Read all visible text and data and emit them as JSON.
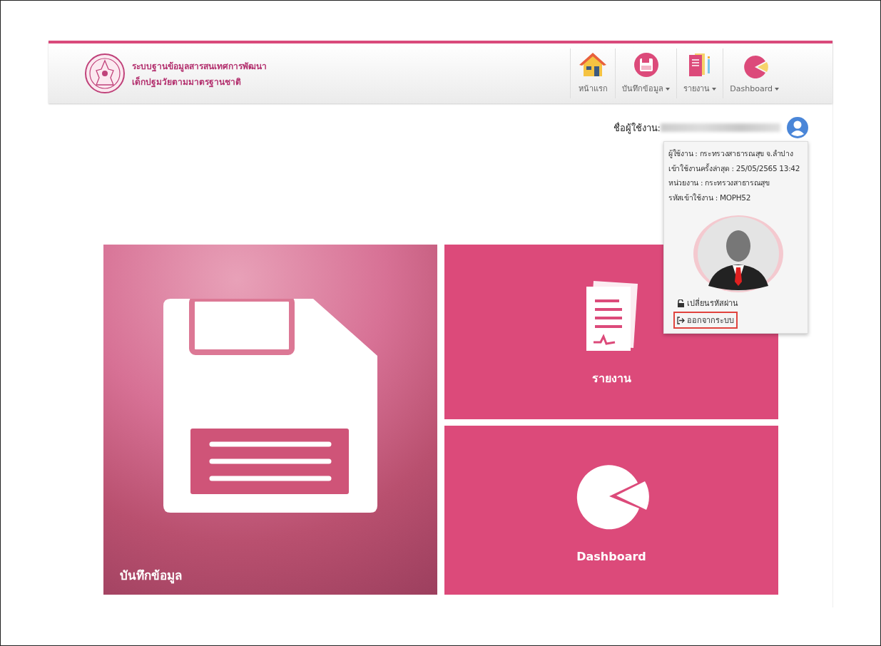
{
  "header": {
    "title_lines": [
      "ระบบฐานข้อมูลสารสนเทศการพัฒนา",
      "เด็กปฐมวัยตามมาตรฐานชาติ"
    ]
  },
  "nav": [
    {
      "kind": "home",
      "label": "หน้าแรก",
      "has_caret": false
    },
    {
      "kind": "save",
      "label": "บันทึกข้อมูล",
      "has_caret": true
    },
    {
      "kind": "report",
      "label": "รายงาน",
      "has_caret": true
    },
    {
      "kind": "chart",
      "label": "Dashboard",
      "has_caret": true
    }
  ],
  "user": {
    "label": "ชื่อผู้ใช้งาน:",
    "expanded": true
  },
  "user_menu": {
    "info": [
      "ผู้ใช้งาน : กระทรวงสาธารณสุข จ.ลำปาง",
      "เข้าใช้งานครั้งล่าสุด : 25/05/2565 13:42",
      "หน่วยงาน : กระทรวงสาธารณสุข",
      "รหัสเข้าใช้งาน : MOPH52"
    ],
    "links": [
      {
        "kind": "lock",
        "label": "เปลี่ยนรหัสผ่าน",
        "highlighted": false
      },
      {
        "kind": "logout",
        "label": "ออกจากระบบ",
        "highlighted": true
      }
    ]
  },
  "tiles": [
    {
      "kind": "save",
      "label": "บันทึกข้อมูล"
    },
    {
      "kind": "report",
      "label": "รายงาน"
    },
    {
      "kind": "chart",
      "label": "Dashboard"
    }
  ]
}
